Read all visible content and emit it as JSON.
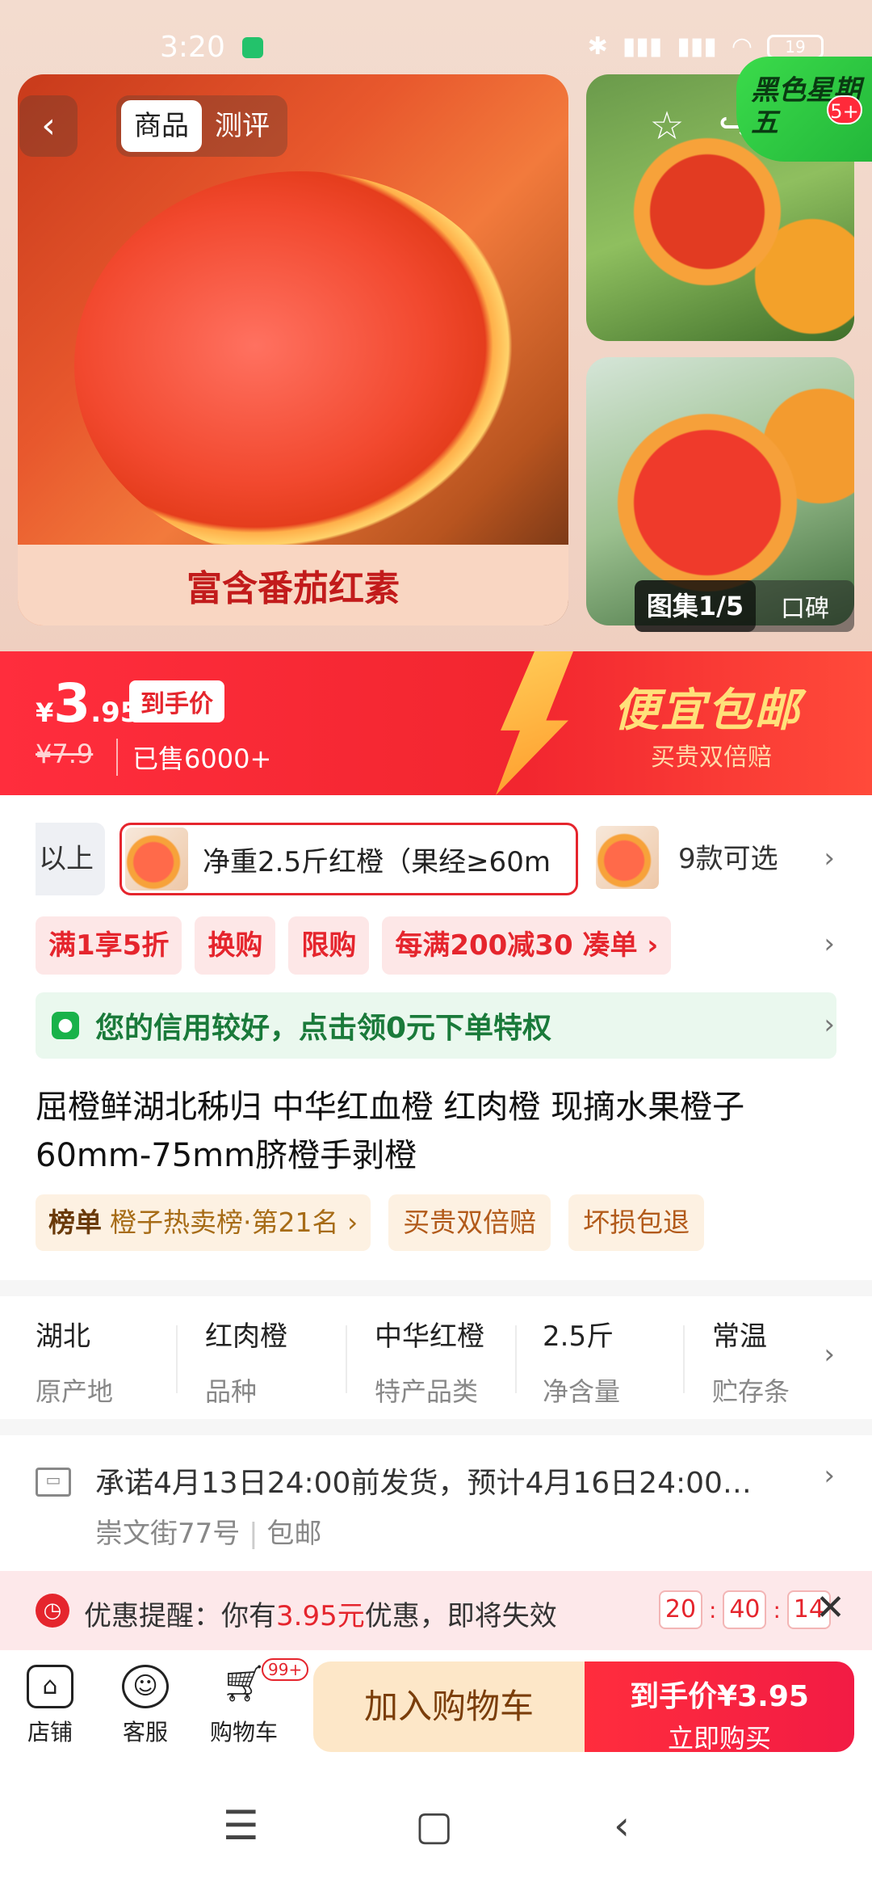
{
  "status_bar": {
    "time": "3:20",
    "battery": "19"
  },
  "hero": {
    "tabs": [
      {
        "label": "商品"
      },
      {
        "label": "测评"
      }
    ],
    "main_caption": "富含番茄红素",
    "promo_badge": {
      "text": "黑色星期五",
      "count": "5+"
    },
    "album": {
      "label": "图集1/5",
      "reviews": "口碑"
    }
  },
  "price": {
    "currency": "¥",
    "integer": "3",
    "decimal": ".95",
    "tag": "到手价",
    "original": "¥7.9",
    "sold": "已售6000+",
    "banner_title": "便宜包邮",
    "banner_sub": "买贵双倍赔"
  },
  "sku": {
    "prev_label": "以上",
    "selected": "净重2.5斤红橙（果经≥60m",
    "more": "9款可选"
  },
  "coupons": [
    {
      "label": "满1享5折"
    },
    {
      "label": "换购"
    },
    {
      "label": "限购"
    },
    {
      "label": "每满200减30 凑单 ›"
    }
  ],
  "credit": {
    "text": "您的信用较好，点击领0元下单特权"
  },
  "product": {
    "title": "屈橙鲜湖北秭归 中华红血橙 红肉橙 现摘水果橙子60mm-75mm脐橙手剥橙",
    "rank_prefix": "榜单",
    "rank_text": "橙子热卖榜·第21名 ›",
    "tags": [
      {
        "label": "买贵双倍赔"
      },
      {
        "label": "坏损包退"
      }
    ]
  },
  "attributes": [
    {
      "value": "湖北",
      "key": "原产地"
    },
    {
      "value": "红肉橙",
      "key": "品种"
    },
    {
      "value": "中华红橙",
      "key": "特产品类"
    },
    {
      "value": "2.5斤",
      "key": "净含量"
    },
    {
      "value": "常温",
      "key": "贮存条"
    }
  ],
  "delivery": {
    "text": "承诺4月13日24:00前发货，预计4月16日24:00…",
    "address": "崇文街77号",
    "shipping": "包邮"
  },
  "reminder": {
    "prefix": "优惠提醒：你有",
    "amount": "3.95元",
    "suffix": "优惠，即将失效",
    "timer": {
      "h": "20",
      "m": "40",
      "s": "14"
    }
  },
  "bottom_bar": {
    "shop": "店铺",
    "service": "客服",
    "cart": "购物车",
    "cart_badge": "99+",
    "add_cart": "加入购物车",
    "buy_top": "到手价¥3.95",
    "buy_sub": "立即购买"
  },
  "icons": {
    "back": "back-icon",
    "favorite": "star-icon",
    "share": "share-icon",
    "chevron": "chevron-right-icon",
    "truck": "truck-icon",
    "clock": "clock-icon",
    "close": "close-icon",
    "shop": "shop-icon",
    "service": "smile-icon",
    "cart": "cart-icon"
  },
  "colors": {
    "accent": "#e5252d",
    "credit": "#19b24a",
    "gold": "#ffe07a"
  }
}
